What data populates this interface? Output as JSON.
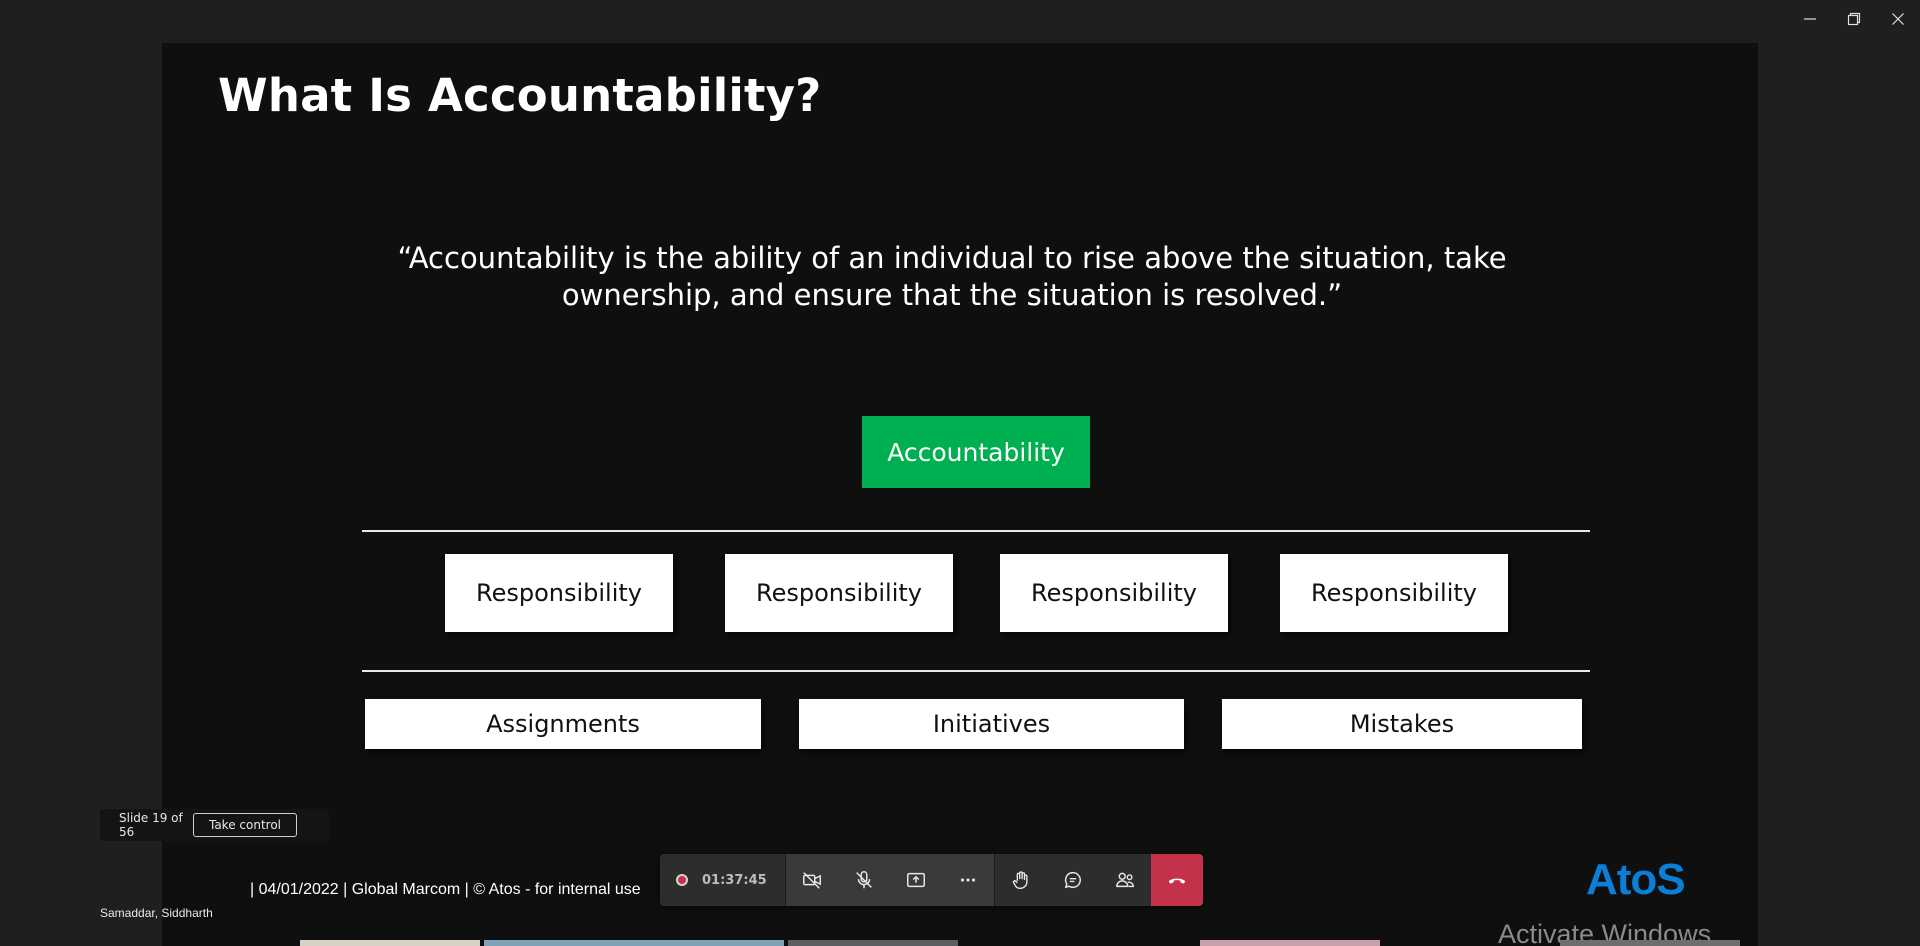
{
  "slide": {
    "title": "What Is Accountability?",
    "quote": "“Accountability is the ability of an individual to rise above the situation, take ownership, and ensure that the situation is resolved.”",
    "center_box": "Accountability",
    "responsibilities": [
      "Responsibility",
      "Responsibility",
      "Responsibility",
      "Responsibility"
    ],
    "bottom_boxes": [
      "Assignments",
      "Initiatives",
      "Mistakes"
    ],
    "footer": "| 04/01/2022 | Global Marcom | © Atos - for internal use",
    "logo": "AtoS",
    "accent_color": "#00b050"
  },
  "watermark": "Activate Windows",
  "presentation": {
    "slide_counter": "Slide 19 of 56",
    "take_control_label": "Take control",
    "presenter": "Samaddar, Siddharth"
  },
  "toolbar": {
    "timer": "01:37:45",
    "buttons": [
      "camera-off-icon",
      "mic-off-icon",
      "share-screen-icon",
      "more-icon",
      "raise-hand-icon",
      "chat-icon",
      "participants-icon",
      "hang-up-icon"
    ],
    "hangup_color": "#c4314b"
  }
}
